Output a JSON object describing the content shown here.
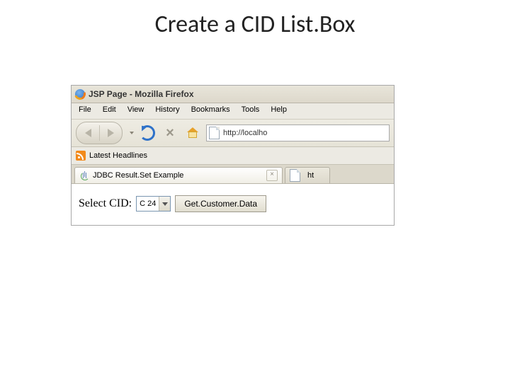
{
  "slide": {
    "title": "Create a CID List.Box"
  },
  "browser": {
    "window_title": "JSP Page - Mozilla Firefox",
    "menus": {
      "file": "File",
      "edit": "Edit",
      "view": "View",
      "history": "History",
      "bookmarks": "Bookmarks",
      "tools": "Tools",
      "help": "Help"
    },
    "url": "http://localho",
    "bookmarks_bar": {
      "latest_headlines": "Latest Headlines"
    },
    "tabs": {
      "active": "JDBC Result.Set Example",
      "inactive": "ht"
    }
  },
  "page": {
    "label": "Select CID:",
    "selected_cid": "C 24",
    "button_label": "Get.Customer.Data"
  }
}
